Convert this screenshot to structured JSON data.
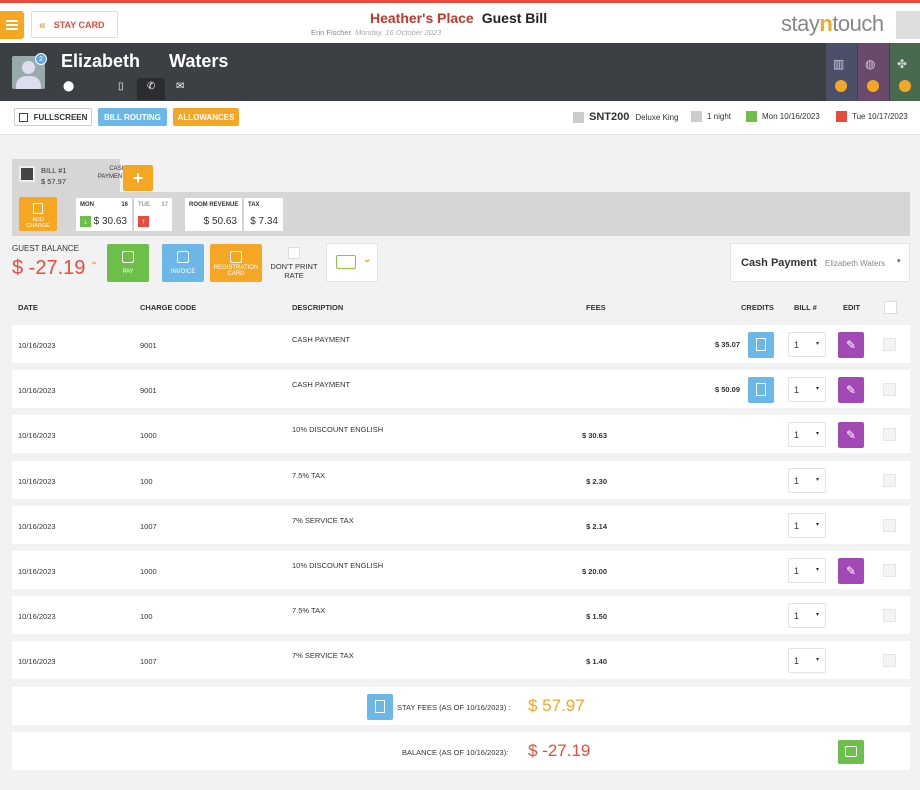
{
  "header": {
    "stay_card_label": "STAY CARD",
    "hotel_name": "Heather's Place",
    "page_title": "Guest Bill",
    "user_name": "Erin Fischer",
    "date": "Monday, 16 October 2023",
    "logo_pre": "stay",
    "logo_n": "n",
    "logo_post": "touch"
  },
  "guest": {
    "first_name": "Elizabeth",
    "last_name": "Waters",
    "badge_count": "2"
  },
  "toolbar": {
    "fullscreen": "FULLSCREEN",
    "bill_routing": "BILL ROUTING",
    "allowances": "ALLOWANCES",
    "room_number": "SNT200",
    "room_type": "Deluxe King",
    "nights": "1 night",
    "arrival": "Mon 10/16/2023",
    "departure": "Tue 10/17/2023"
  },
  "bill_tab": {
    "bill_label": "BILL #1",
    "amount": "$ 57.97",
    "type_line1": "CASH",
    "type_line2": "PAYMENT",
    "add_label": "+"
  },
  "summary": {
    "add_charge_line1": "ADD",
    "add_charge_line2": "CHARGE",
    "day1_name": "MON",
    "day1_num": "16",
    "day1_value": "$ 30.63",
    "day2_name": "TUE",
    "day2_num": "17",
    "room_revenue_label": "ROOM REVENUE",
    "room_revenue_value": "$ 50.63",
    "tax_label": "TAX",
    "tax_value": "$ 7.34"
  },
  "actions": {
    "guest_balance_label": "GUEST BALANCE",
    "guest_balance_value": "$ -27.19",
    "pay": "PAY",
    "invoice": "INVOICE",
    "registration_line1": "REGISTRATION",
    "registration_line2": "CARD",
    "dont_print_line1": "DON'T PRINT",
    "dont_print_line2": "RATE",
    "payment_type": "Cash Payment",
    "payment_name": "Elizabeth Waters"
  },
  "columns": {
    "date": "DATE",
    "charge_code": "CHARGE CODE",
    "description": "DESCRIPTION",
    "fees": "FEES",
    "credits": "CREDITS",
    "bill_no": "BILL #",
    "edit": "EDIT"
  },
  "rows": [
    {
      "date": "10/16/2023",
      "code": "9001",
      "desc": "CASH PAYMENT",
      "fee": "",
      "credit": "$ 35.07",
      "bill": "1"
    },
    {
      "date": "10/16/2023",
      "code": "9001",
      "desc": "CASH PAYMENT",
      "fee": "",
      "credit": "$ 50.09",
      "bill": "1"
    },
    {
      "date": "10/16/2023",
      "code": "1000",
      "desc": "10% DISCOUNT ENGLISH",
      "fee": "$ 30.63",
      "credit": "",
      "bill": "1"
    },
    {
      "date": "10/16/2023",
      "code": "100",
      "desc": "7.5% TAX",
      "fee": "$ 2.30",
      "credit": "",
      "bill": "1"
    },
    {
      "date": "10/16/2023",
      "code": "1007",
      "desc": "7% SERVICE TAX",
      "fee": "$ 2.14",
      "credit": "",
      "bill": "1"
    },
    {
      "date": "10/16/2023",
      "code": "1000",
      "desc": "10% DISCOUNT ENGLISH",
      "fee": "$ 20.00",
      "credit": "",
      "bill": "1"
    },
    {
      "date": "10/16/2023",
      "code": "100",
      "desc": "7.5% TAX",
      "fee": "$ 1.50",
      "credit": "",
      "bill": "1"
    },
    {
      "date": "10/16/2023",
      "code": "1007",
      "desc": "7% SERVICE TAX",
      "fee": "$ 1.40",
      "credit": "",
      "bill": "1"
    }
  ],
  "footer": {
    "stay_fees_label": "STAY FEES (AS OF  10/16/2023) :",
    "stay_fees_value": "$ 57.97",
    "balance_label": "BALANCE (AS OF  10/16/2023):",
    "balance_value": "$ -27.19"
  },
  "colors": {
    "accent_orange": "#f5a623",
    "brand_red": "#e74c3c",
    "info_blue": "#6ab7e8",
    "edit_purple": "#a349b5",
    "pay_green": "#6cc04a"
  }
}
